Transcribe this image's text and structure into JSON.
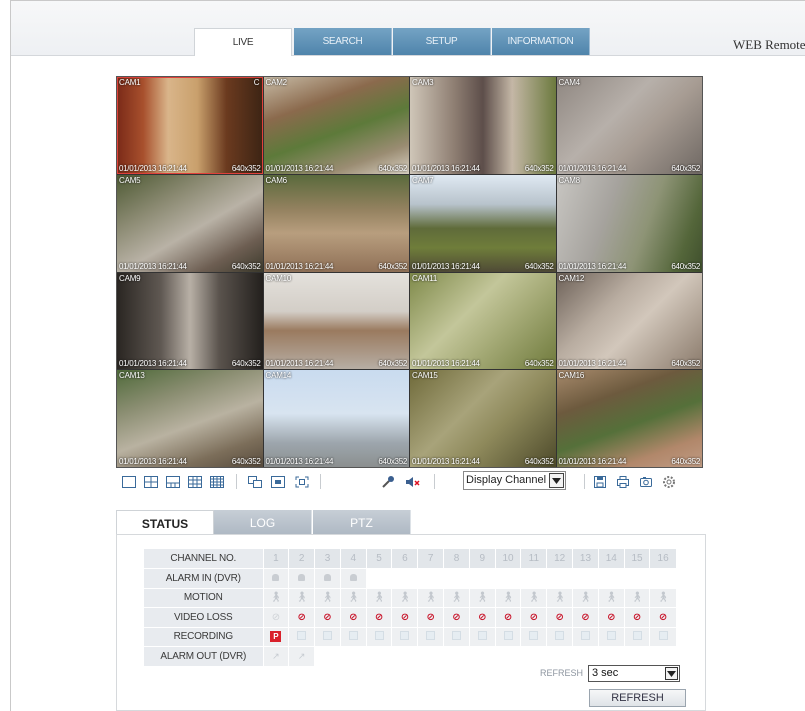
{
  "app": {
    "brand": "WEB Remote"
  },
  "nav": {
    "tabs": [
      {
        "label": "LIVE",
        "active": true
      },
      {
        "label": "SEARCH",
        "active": false
      },
      {
        "label": "SETUP",
        "active": false
      },
      {
        "label": "INFORMATION",
        "active": false
      }
    ]
  },
  "cameras": [
    {
      "label": "CAM1",
      "flag": "C",
      "timestamp": "01/01/2013 16:21:44",
      "resolution": "640x352",
      "selected": true
    },
    {
      "label": "CAM2",
      "timestamp": "01/01/2013 16:21:44",
      "resolution": "640x352"
    },
    {
      "label": "CAM3",
      "timestamp": "01/01/2013 16:21:44",
      "resolution": "640x352"
    },
    {
      "label": "CAM4",
      "timestamp": "01/01/2013 16:21:44",
      "resolution": "640x352"
    },
    {
      "label": "CAM5",
      "timestamp": "01/01/2013 16:21:44",
      "resolution": "640x352"
    },
    {
      "label": "CAM6",
      "timestamp": "01/01/2013 16:21:44",
      "resolution": "640x352"
    },
    {
      "label": "CAM7",
      "timestamp": "01/01/2013 16:21:44",
      "resolution": "640x352"
    },
    {
      "label": "CAM8",
      "timestamp": "01/01/2013 16:21:44",
      "resolution": "640x352"
    },
    {
      "label": "CAM9",
      "timestamp": "01/01/2013 16:21:44",
      "resolution": "640x352"
    },
    {
      "label": "CAM10",
      "timestamp": "01/01/2013 16:21:44",
      "resolution": "640x352"
    },
    {
      "label": "CAM11",
      "timestamp": "01/01/2013 16:21:44",
      "resolution": "640x352"
    },
    {
      "label": "CAM12",
      "timestamp": "01/01/2013 16:21:44",
      "resolution": "640x352"
    },
    {
      "label": "CAM13",
      "timestamp": "01/01/2013 16:21:44",
      "resolution": "640x352"
    },
    {
      "label": "CAM14",
      "timestamp": "01/01/2013 16:21:44",
      "resolution": "640x352"
    },
    {
      "label": "CAM15",
      "timestamp": "01/01/2013 16:21:44",
      "resolution": "640x352"
    },
    {
      "label": "CAM16",
      "timestamp": "01/01/2013 16:21:44",
      "resolution": "640x352"
    }
  ],
  "toolbar": {
    "display_channel": "Display Channel",
    "icons": [
      "single-view-icon",
      "quad-view-icon",
      "split-6-view-icon",
      "split-9-view-icon",
      "split-16-view-icon",
      "sequence-icon",
      "osd-icon",
      "fullscreen-icon",
      "audio-mic-icon",
      "speaker-mute-icon",
      "save-icon",
      "print-icon",
      "snapshot-icon",
      "settings-icon"
    ]
  },
  "status_tabs": [
    {
      "label": "STATUS",
      "active": true
    },
    {
      "label": "LOG",
      "active": false
    },
    {
      "label": "PTZ",
      "active": false
    }
  ],
  "status": {
    "rows": {
      "channel_no": "CHANNEL NO.",
      "alarm_in": "ALARM IN (DVR)",
      "motion": "MOTION",
      "video_loss": "VIDEO LOSS",
      "recording": "RECORDING",
      "alarm_out": "ALARM OUT (DVR)"
    },
    "channels": [
      "1",
      "2",
      "3",
      "4",
      "5",
      "6",
      "7",
      "8",
      "9",
      "10",
      "11",
      "12",
      "13",
      "14",
      "15",
      "16"
    ],
    "alarm_in_count": 4,
    "alarm_out_count": 2,
    "video_loss_active": [
      false,
      true,
      true,
      true,
      true,
      true,
      true,
      true,
      true,
      true,
      true,
      true,
      true,
      true,
      true,
      true
    ],
    "recording_marker": "P",
    "recording_marker_channel": 1
  },
  "refresh": {
    "label": "REFRESH",
    "interval": "3 sec",
    "button": "REFRESH"
  }
}
